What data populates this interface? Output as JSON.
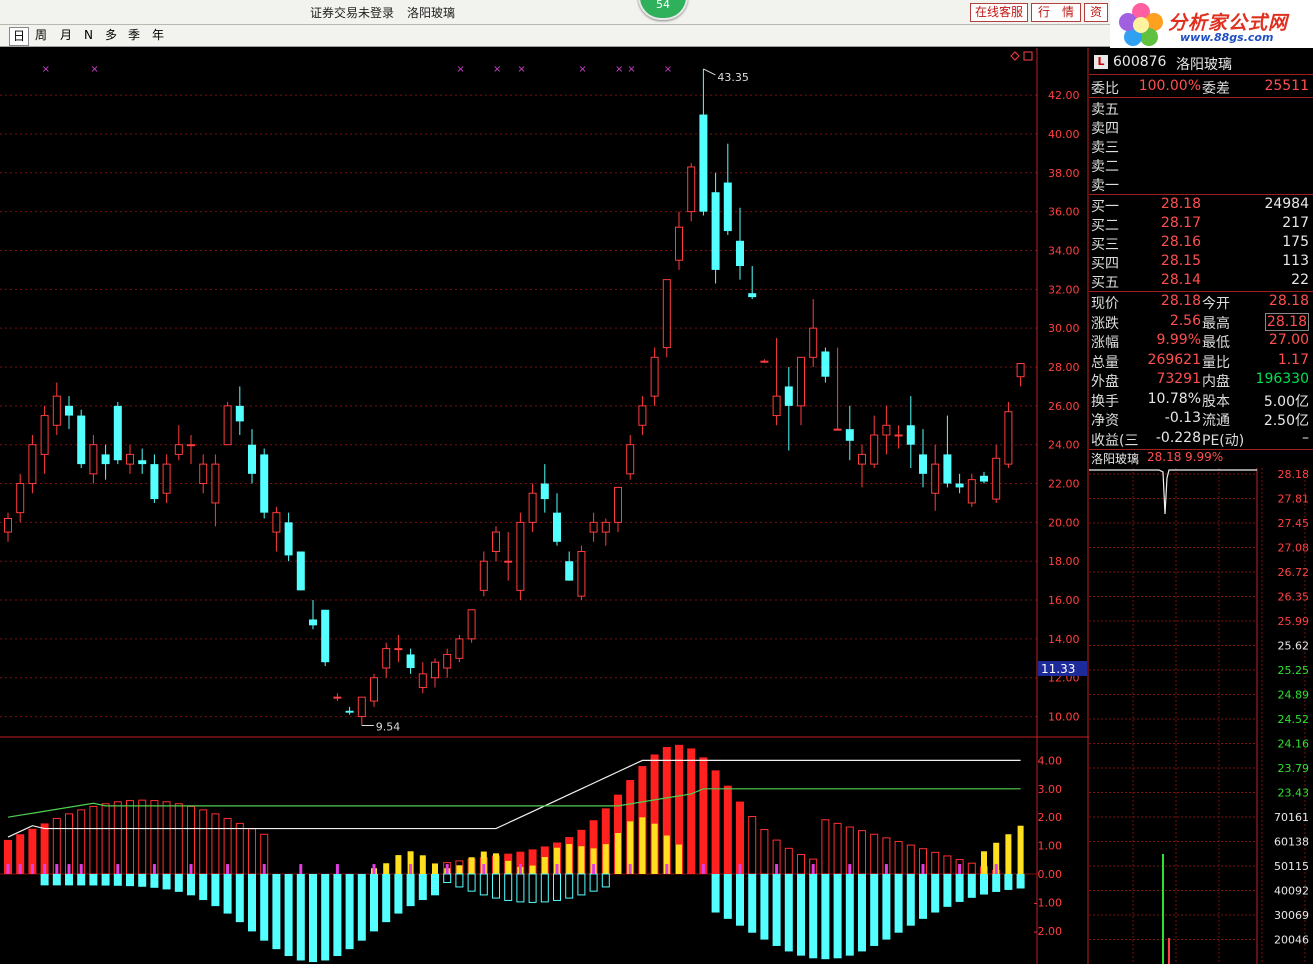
{
  "topbar": {
    "status": "证券交易未登录",
    "stock_name": "洛阳玻璃",
    "badge": "54",
    "buttons": [
      "在线客服",
      "行　情",
      "资"
    ]
  },
  "tabs": [
    {
      "label": "日",
      "selected": true
    },
    {
      "label": "周"
    },
    {
      "label": "月"
    },
    {
      "label": "N"
    },
    {
      "label": "多"
    },
    {
      "label": "季"
    },
    {
      "label": "年"
    }
  ],
  "logo": {
    "title": "分析家公式网",
    "url": "www.88gs.com"
  },
  "chart_data": {
    "type": "candlestick",
    "y_ticks": [
      "42.00",
      "40.00",
      "38.00",
      "36.00",
      "34.00",
      "32.00",
      "30.00",
      "28.00",
      "26.00",
      "24.00",
      "22.00",
      "20.00",
      "18.00",
      "16.00",
      "14.00",
      "12.00",
      "10.00"
    ],
    "ylim": [
      9,
      43.5
    ],
    "high_label": "43.35",
    "low_label": "9.54",
    "cursor_price": "11.33",
    "candles": [
      {
        "o": 19.5,
        "h": 20.5,
        "l": 19,
        "c": 20.2
      },
      {
        "o": 20.5,
        "h": 22.5,
        "l": 20,
        "c": 22
      },
      {
        "o": 22,
        "h": 24.5,
        "l": 21.5,
        "c": 24
      },
      {
        "o": 23.5,
        "h": 26,
        "l": 22.5,
        "c": 25.5
      },
      {
        "o": 25,
        "h": 27.2,
        "l": 24.5,
        "c": 26.5
      },
      {
        "o": 26,
        "h": 26.5,
        "l": 24.8,
        "c": 25.5
      },
      {
        "o": 25.5,
        "h": 25.8,
        "l": 22.8,
        "c": 23
      },
      {
        "o": 22.5,
        "h": 24.5,
        "l": 22,
        "c": 24
      },
      {
        "o": 23.5,
        "h": 24,
        "l": 22.2,
        "c": 23
      },
      {
        "o": 26,
        "h": 26.2,
        "l": 23,
        "c": 23.2
      },
      {
        "o": 23,
        "h": 24,
        "l": 22.5,
        "c": 23.5
      },
      {
        "o": 23.2,
        "h": 23.8,
        "l": 22.5,
        "c": 23
      },
      {
        "o": 23,
        "h": 23.5,
        "l": 21,
        "c": 21.2
      },
      {
        "o": 21.5,
        "h": 23.5,
        "l": 21,
        "c": 23
      },
      {
        "o": 23.5,
        "h": 25,
        "l": 23.2,
        "c": 24
      },
      {
        "o": 24,
        "h": 24.5,
        "l": 23,
        "c": 24
      },
      {
        "o": 22,
        "h": 23.5,
        "l": 21.5,
        "c": 23
      },
      {
        "o": 21,
        "h": 23.5,
        "l": 19.8,
        "c": 23
      },
      {
        "o": 24,
        "h": 26.2,
        "l": 24,
        "c": 26
      },
      {
        "o": 26,
        "h": 27,
        "l": 24.5,
        "c": 25.2
      },
      {
        "o": 24,
        "h": 24.8,
        "l": 22,
        "c": 22.5
      },
      {
        "o": 23.5,
        "h": 23.8,
        "l": 20.2,
        "c": 20.5
      },
      {
        "o": 19.5,
        "h": 20.8,
        "l": 18.5,
        "c": 20.5
      },
      {
        "o": 20,
        "h": 20.5,
        "l": 18,
        "c": 18.3
      },
      {
        "o": 18.5,
        "h": 18.5,
        "l": 16.5,
        "c": 16.5
      },
      {
        "o": 15,
        "h": 16,
        "l": 14.5,
        "c": 14.7
      },
      {
        "o": 15.5,
        "h": 15.5,
        "l": 12.6,
        "c": 12.8
      },
      {
        "o": 11,
        "h": 11.2,
        "l": 10.8,
        "c": 11
      },
      {
        "o": 10.3,
        "h": 10.5,
        "l": 10.1,
        "c": 10.2
      },
      {
        "o": 10,
        "h": 11,
        "l": 9.54,
        "c": 11
      },
      {
        "o": 10.8,
        "h": 12.2,
        "l": 10.5,
        "c": 12
      },
      {
        "o": 12.5,
        "h": 13.8,
        "l": 12,
        "c": 13.5
      },
      {
        "o": 13.5,
        "h": 14.2,
        "l": 12.8,
        "c": 13.5
      },
      {
        "o": 13.2,
        "h": 13.5,
        "l": 12.2,
        "c": 12.5
      },
      {
        "o": 11.5,
        "h": 12.8,
        "l": 11.2,
        "c": 12.2
      },
      {
        "o": 12,
        "h": 13,
        "l": 11.5,
        "c": 12.8
      },
      {
        "o": 12.5,
        "h": 13.5,
        "l": 12,
        "c": 13.2
      },
      {
        "o": 13,
        "h": 14.2,
        "l": 12.8,
        "c": 14
      },
      {
        "o": 14,
        "h": 15.5,
        "l": 13.8,
        "c": 15.5
      },
      {
        "o": 16.5,
        "h": 18.5,
        "l": 16.2,
        "c": 18
      },
      {
        "o": 18.5,
        "h": 19.8,
        "l": 18,
        "c": 19.5
      },
      {
        "o": 18,
        "h": 19.5,
        "l": 17,
        "c": 18
      },
      {
        "o": 16.5,
        "h": 20.5,
        "l": 16,
        "c": 20
      },
      {
        "o": 20,
        "h": 22,
        "l": 19.5,
        "c": 21.5
      },
      {
        "o": 22,
        "h": 23,
        "l": 20.5,
        "c": 21.2
      },
      {
        "o": 20.5,
        "h": 21.5,
        "l": 18.8,
        "c": 19
      },
      {
        "o": 18,
        "h": 18.5,
        "l": 17,
        "c": 17
      },
      {
        "o": 16.2,
        "h": 18.8,
        "l": 16,
        "c": 18.5
      },
      {
        "o": 19.5,
        "h": 20.5,
        "l": 19,
        "c": 20
      },
      {
        "o": 19.5,
        "h": 20.2,
        "l": 18.8,
        "c": 20
      },
      {
        "o": 20,
        "h": 21.8,
        "l": 19.5,
        "c": 21.8
      },
      {
        "o": 22.5,
        "h": 24.5,
        "l": 22.2,
        "c": 24
      },
      {
        "o": 25,
        "h": 26.5,
        "l": 24.5,
        "c": 26
      },
      {
        "o": 26.5,
        "h": 29,
        "l": 26,
        "c": 28.5
      },
      {
        "o": 29,
        "h": 32.5,
        "l": 28.5,
        "c": 32.5
      },
      {
        "o": 33.5,
        "h": 36,
        "l": 33,
        "c": 35.2
      },
      {
        "o": 36,
        "h": 38.5,
        "l": 35.5,
        "c": 38.3
      },
      {
        "o": 41,
        "h": 43.35,
        "l": 35.8,
        "c": 36
      },
      {
        "o": 37,
        "h": 38,
        "l": 32.3,
        "c": 33
      },
      {
        "o": 37.5,
        "h": 39.5,
        "l": 34.8,
        "c": 35
      },
      {
        "o": 34.5,
        "h": 36.2,
        "l": 32.5,
        "c": 33.2
      },
      {
        "o": 31.8,
        "h": 33.2,
        "l": 31.5,
        "c": 31.6
      },
      {
        "o": 28.3,
        "h": 28.4,
        "l": 28.2,
        "c": 28.3
      },
      {
        "o": 25.5,
        "h": 29.5,
        "l": 25,
        "c": 26.5
      },
      {
        "o": 27,
        "h": 28,
        "l": 23.7,
        "c": 26
      },
      {
        "o": 26,
        "h": 28.5,
        "l": 25,
        "c": 28.5
      },
      {
        "o": 28.5,
        "h": 31.5,
        "l": 28,
        "c": 30
      },
      {
        "o": 28.8,
        "h": 29,
        "l": 27.2,
        "c": 27.5
      },
      {
        "o": 24.8,
        "h": 29,
        "l": 24.8,
        "c": 24.8
      },
      {
        "o": 24.8,
        "h": 26,
        "l": 23.2,
        "c": 24.2
      },
      {
        "o": 23,
        "h": 24,
        "l": 21.8,
        "c": 23.5
      },
      {
        "o": 23,
        "h": 25.5,
        "l": 22.8,
        "c": 24.5
      },
      {
        "o": 24.5,
        "h": 26,
        "l": 23.5,
        "c": 25
      },
      {
        "o": 24.5,
        "h": 25,
        "l": 23.8,
        "c": 24.5
      },
      {
        "o": 25,
        "h": 26.5,
        "l": 22.8,
        "c": 24
      },
      {
        "o": 23.5,
        "h": 24.8,
        "l": 21.8,
        "c": 22.5
      },
      {
        "o": 21.5,
        "h": 24,
        "l": 20.6,
        "c": 23
      },
      {
        "o": 23.5,
        "h": 25.5,
        "l": 21.8,
        "c": 22
      },
      {
        "o": 22,
        "h": 22.5,
        "l": 21.5,
        "c": 21.8
      },
      {
        "o": 21,
        "h": 22.5,
        "l": 20.8,
        "c": 22.2
      },
      {
        "o": 22.4,
        "h": 22.6,
        "l": 22,
        "c": 22.1
      },
      {
        "o": 21.2,
        "h": 24,
        "l": 21,
        "c": 23.3
      },
      {
        "o": 23,
        "h": 26.2,
        "l": 22.8,
        "c": 25.7
      },
      {
        "o": 27.5,
        "h": 28.2,
        "l": 27,
        "c": 28.18
      }
    ],
    "indicator": {
      "y_ticks": [
        "4.00",
        "3.00",
        "2.00",
        "1.00",
        "0.00",
        "-1.00",
        "-2.00"
      ]
    },
    "intraday_ticks": [
      "28.18",
      "27.81",
      "27.45",
      "27.08",
      "26.72",
      "26.35",
      "25.99",
      "25.62",
      "25.25",
      "24.89",
      "24.52",
      "24.16",
      "23.79",
      "23.43",
      "70161",
      "60138",
      "50115",
      "40092",
      "30069",
      "20046"
    ]
  },
  "panel": {
    "code_icon": "L",
    "code": "600876",
    "name": "洛阳玻璃",
    "webi_label": "委比",
    "webi_value": "100.00%",
    "weicha_label": "委差",
    "weicha_value": "25511",
    "sell": [
      "卖五",
      "卖四",
      "卖三",
      "卖二",
      "卖一"
    ],
    "buy": [
      {
        "label": "买一",
        "price": "28.18",
        "vol": "24984"
      },
      {
        "label": "买二",
        "price": "28.17",
        "vol": "217"
      },
      {
        "label": "买三",
        "price": "28.16",
        "vol": "175"
      },
      {
        "label": "买四",
        "price": "28.15",
        "vol": "113"
      },
      {
        "label": "买五",
        "price": "28.14",
        "vol": "22"
      }
    ],
    "stats": [
      {
        "l1": "现价",
        "v1": "28.18",
        "l2": "今开",
        "v2": "28.18"
      },
      {
        "l1": "涨跌",
        "v1": "2.56",
        "l2": "最高",
        "v2": "28.18"
      },
      {
        "l1": "涨幅",
        "v1": "9.99%",
        "l2": "最低",
        "v2": "27.00"
      },
      {
        "l1": "总量",
        "v1": "269621",
        "l2": "量比",
        "v2": "1.17"
      },
      {
        "l1": "外盘",
        "v1": "73291",
        "l2": "内盘",
        "v2": "196330"
      },
      {
        "l1": "换手",
        "v1": "10.78%",
        "l2": "股本",
        "v2": "5.00亿"
      },
      {
        "l1": "净资",
        "v1": "-0.13",
        "l2": "流通",
        "v2": "2.50亿"
      },
      {
        "l1": "收益(三",
        "v1": "-0.228",
        "l2": "PE(动)",
        "v2": "–"
      }
    ],
    "mini_title": "洛阳玻璃",
    "mini_price": "28.18",
    "mini_pct": "9.99%"
  }
}
